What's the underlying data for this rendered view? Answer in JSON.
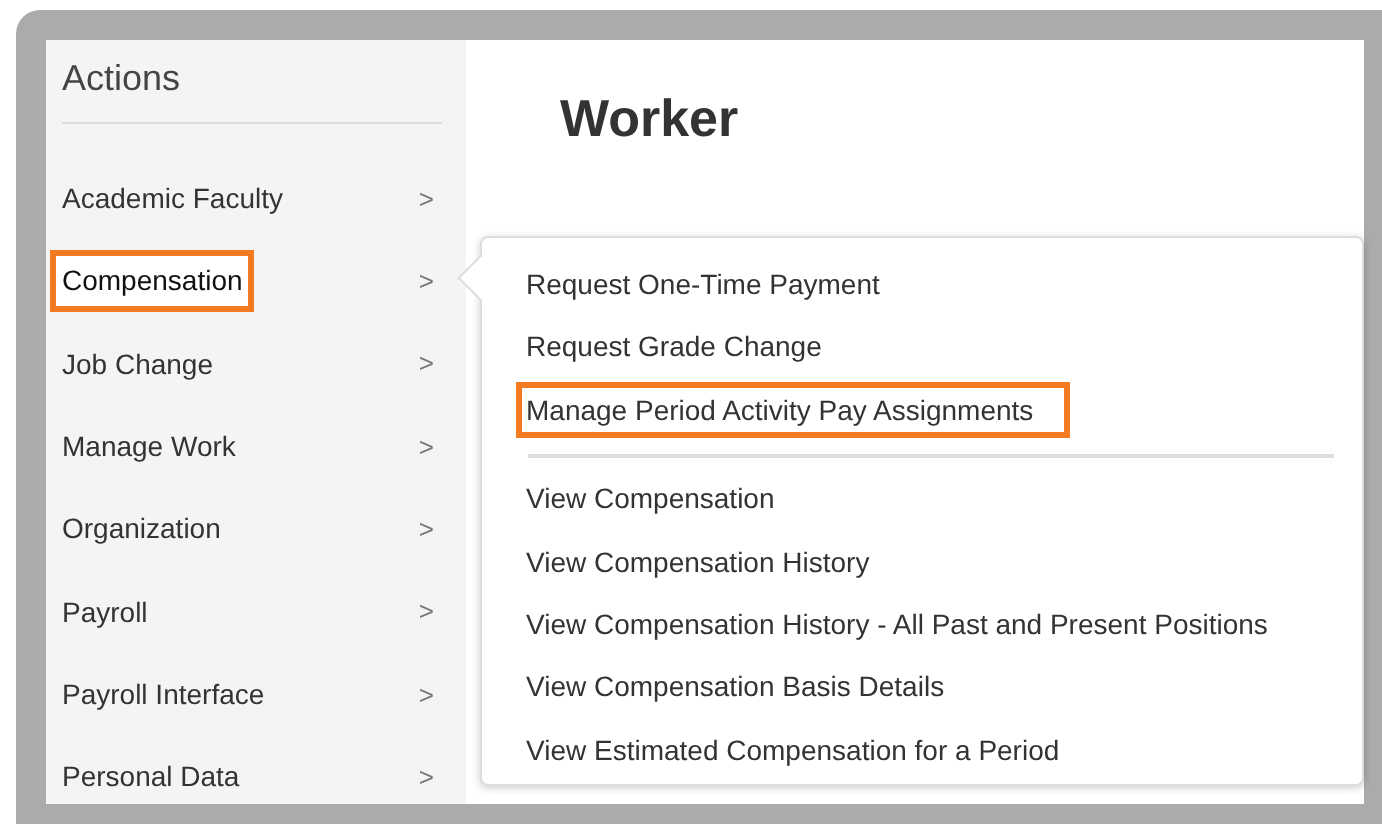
{
  "sidebar": {
    "title": "Actions",
    "items": [
      {
        "label": "Academic Faculty",
        "chevron": ">",
        "selected": false,
        "highlighted": false
      },
      {
        "label": "Compensation",
        "chevron": ">",
        "selected": true,
        "highlighted": true
      },
      {
        "label": "Job Change",
        "chevron": ">",
        "selected": false,
        "highlighted": false
      },
      {
        "label": "Manage Work",
        "chevron": ">",
        "selected": false,
        "highlighted": false
      },
      {
        "label": "Organization",
        "chevron": ">",
        "selected": false,
        "highlighted": false
      },
      {
        "label": "Payroll",
        "chevron": ">",
        "selected": false,
        "highlighted": false
      },
      {
        "label": "Payroll Interface",
        "chevron": ">",
        "selected": false,
        "highlighted": false
      },
      {
        "label": "Personal Data",
        "chevron": ">",
        "selected": false,
        "highlighted": false
      }
    ]
  },
  "main": {
    "title": "Worker"
  },
  "submenu": {
    "groups": [
      {
        "items": [
          {
            "label": "Request One-Time Payment",
            "highlighted": false
          },
          {
            "label": "Request Grade Change",
            "highlighted": false
          },
          {
            "label": "Manage Period Activity Pay Assignments",
            "highlighted": true
          }
        ]
      },
      {
        "items": [
          {
            "label": "View Compensation",
            "highlighted": false
          },
          {
            "label": "View Compensation History",
            "highlighted": false
          },
          {
            "label": "View Compensation History - All Past and Present Positions",
            "highlighted": false
          },
          {
            "label": "View Compensation Basis Details",
            "highlighted": false
          },
          {
            "label": "View Estimated Compensation for a Period",
            "highlighted": false
          }
        ]
      }
    ]
  }
}
